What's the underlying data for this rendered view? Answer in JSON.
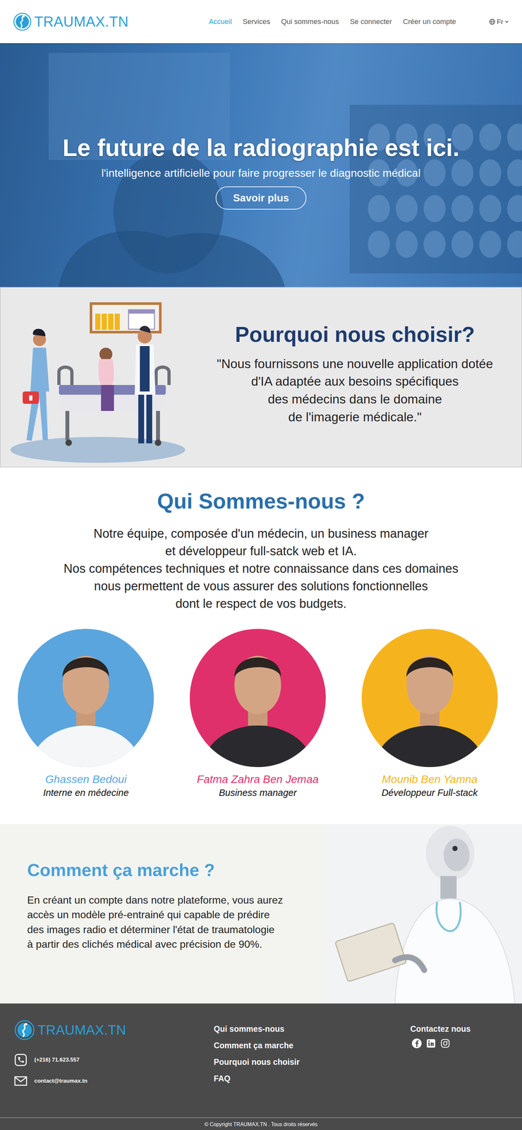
{
  "nav": {
    "logo": "TRAUMAX.TN",
    "links": [
      {
        "label": "Accueil",
        "selected": true
      },
      {
        "label": "Services",
        "selected": false
      },
      {
        "label": "Qui sommes-nous",
        "selected": false
      },
      {
        "label": "Se connecter",
        "selected": false
      },
      {
        "label": "Créer un compte",
        "selected": false
      }
    ],
    "language": "Fr"
  },
  "hero": {
    "title": "Le future de la radiographie est ici.",
    "subtitle": "l'intelligence artificielle pour faire progresser le diagnostic médical",
    "button": "Savoir plus"
  },
  "why": {
    "title": "Pourquoi nous choisir?",
    "quote": [
      "\"Nous fournissons une nouvelle application dotée",
      "d'IA adaptée aux besoins spécifiques",
      "des médecins dans le domaine",
      "de l'imagerie médicale.\""
    ]
  },
  "about": {
    "title": "Qui Sommes-nous ?",
    "paragraph": [
      "Notre équipe, composée d'un médecin, un business manager",
      "et développeur full-satck web et IA.",
      "Nos compétences techniques et notre connaissance dans ces domaines",
      "nous permettent de vous assurer des solutions fonctionnelles",
      "dont le respect de vos budgets."
    ],
    "team": [
      {
        "name": "Ghassen Bedoui",
        "role": "Interne en médecine",
        "color": "#5aa5de"
      },
      {
        "name": "Fatma Zahra Ben Jemaa",
        "role": "Business manager",
        "color": "#e0306b"
      },
      {
        "name": "Mounib Ben Yamna",
        "role": "Développeur Full-stack",
        "color": "#f5b41e"
      }
    ]
  },
  "how": {
    "title": "Comment ça marche ?",
    "paragraph": [
      "En créant un compte dans notre plateforme, vous aurez",
      "accès un modèle pré-entrainé qui capable de prédire",
      "des images radio et déterminer l'état de traumatologie",
      "à partir des clichés médical avec précision de 90%."
    ]
  },
  "footer": {
    "logo": "TRAUMAX.TN",
    "phone": "(+216) 71.623.557",
    "email": "contact@traumax.tn",
    "links": [
      "Qui sommes-nous",
      "Comment ça marche",
      "Pourquoi nous choisir",
      "FAQ"
    ],
    "contact_title": "Contactez nous",
    "copyright": "© Copyright TRAUMAX.TN . Tous droits réservés"
  }
}
